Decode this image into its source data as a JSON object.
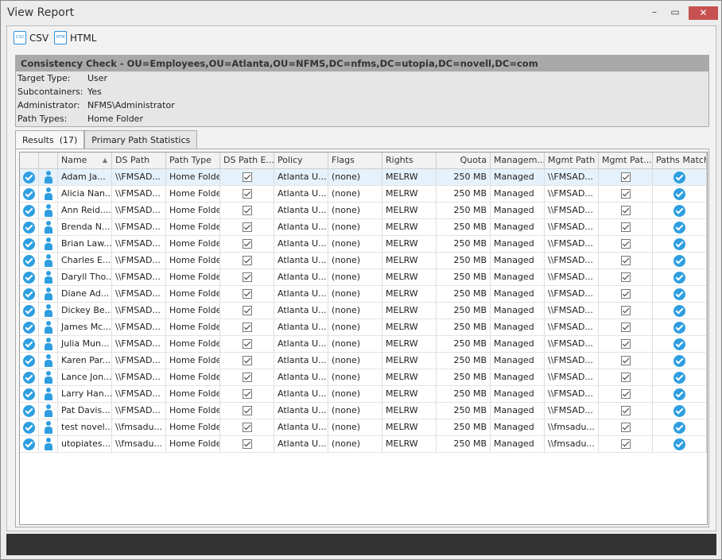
{
  "window": {
    "title": "View Report",
    "minimize": "–",
    "maximize": "▭",
    "close": "✕"
  },
  "toolbar": {
    "csv": "CSV",
    "html": "HTML",
    "csv_icon": "csv-file-icon",
    "html_icon": "html-file-icon"
  },
  "report": {
    "heading": "Consistency Check - OU=Employees,OU=Atlanta,OU=NFMS,DC=nfms,DC=utopia,DC=novell,DC=com",
    "fields": [
      {
        "label": "Target Type:",
        "value": "User"
      },
      {
        "label": "Subcontainers:",
        "value": "Yes"
      },
      {
        "label": "Administrator:",
        "value": "NFMS\\Administrator"
      },
      {
        "label": "Path Types:",
        "value": "Home Folder"
      }
    ]
  },
  "tabs": [
    {
      "label": "Results  (17)"
    },
    {
      "label": "Primary Path Statistics"
    }
  ],
  "columns": [
    "",
    "",
    "Name",
    "DS Path",
    "Path Type",
    "DS Path E...",
    "Policy",
    "Flags",
    "Rights",
    "Quota",
    "Managem...",
    "Mgmt Path",
    "Mgmt Pat...",
    "Paths Match"
  ],
  "rows": [
    {
      "name": "Adam Ja...",
      "ds": "\\\\FMSAD...",
      "mp": "\\\\FMSAD..."
    },
    {
      "name": "Alicia Nan...",
      "ds": "\\\\FMSAD...",
      "mp": "\\\\FMSAD..."
    },
    {
      "name": "Ann Reid....",
      "ds": "\\\\FMSAD...",
      "mp": "\\\\FMSAD..."
    },
    {
      "name": "Brenda N...",
      "ds": "\\\\FMSAD...",
      "mp": "\\\\FMSAD..."
    },
    {
      "name": "Brian Law...",
      "ds": "\\\\FMSAD...",
      "mp": "\\\\FMSAD..."
    },
    {
      "name": "Charles E...",
      "ds": "\\\\FMSAD...",
      "mp": "\\\\FMSAD..."
    },
    {
      "name": "Daryll Tho...",
      "ds": "\\\\FMSAD...",
      "mp": "\\\\FMSAD..."
    },
    {
      "name": "Diane Ad...",
      "ds": "\\\\FMSAD...",
      "mp": "\\\\FMSAD..."
    },
    {
      "name": "Dickey Be...",
      "ds": "\\\\FMSAD...",
      "mp": "\\\\FMSAD..."
    },
    {
      "name": "James Mc...",
      "ds": "\\\\FMSAD...",
      "mp": "\\\\FMSAD..."
    },
    {
      "name": "Julia Mun...",
      "ds": "\\\\FMSAD...",
      "mp": "\\\\FMSAD..."
    },
    {
      "name": "Karen Par...",
      "ds": "\\\\FMSAD...",
      "mp": "\\\\FMSAD..."
    },
    {
      "name": "Lance Jon...",
      "ds": "\\\\FMSAD...",
      "mp": "\\\\FMSAD..."
    },
    {
      "name": "Larry Han...",
      "ds": "\\\\FMSAD...",
      "mp": "\\\\FMSAD..."
    },
    {
      "name": "Pat Davis...",
      "ds": "\\\\FMSAD...",
      "mp": "\\\\FMSAD..."
    },
    {
      "name": "test novel...",
      "ds": "\\\\fmsadu...",
      "mp": "\\\\fmsadu..."
    },
    {
      "name": "utopiates...",
      "ds": "\\\\fmsadu...",
      "mp": "\\\\fmsadu..."
    }
  ],
  "common": {
    "pathType": "Home Folder",
    "policy": "Atlanta U...",
    "flags": "(none)",
    "rights": "MELRW",
    "quota": "250 MB",
    "mgmt": "Managed",
    "dsExists": true,
    "mgmtExists": true,
    "pathsMatch": true
  },
  "colors": {
    "accent": "#2e9ee0",
    "close": "#c75050",
    "selected": "#e5f1fb"
  }
}
